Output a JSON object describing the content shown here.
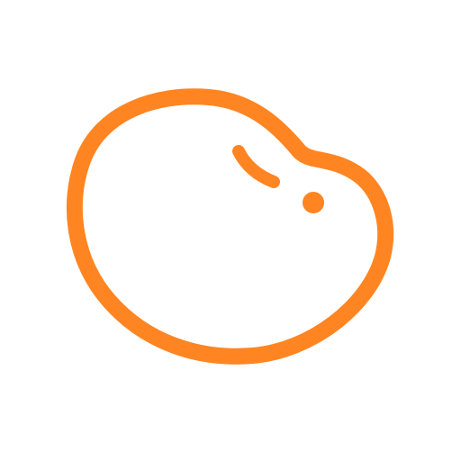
{
  "icon": {
    "name": "bean-icon",
    "stroke_color": "#FF8522",
    "background_color": "#FFFFFF"
  }
}
